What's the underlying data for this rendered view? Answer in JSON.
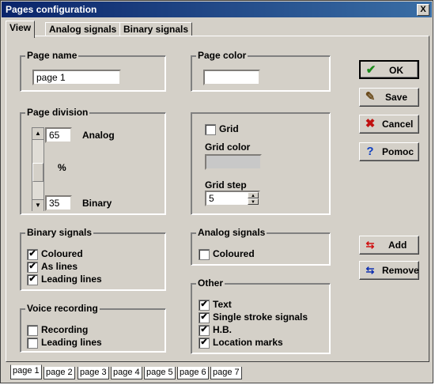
{
  "window": {
    "title": "Pages configuration",
    "close_label": "X"
  },
  "tabs": [
    "View",
    "Analog signals",
    "Binary signals"
  ],
  "page_name": {
    "title": "Page name",
    "value": "page 1"
  },
  "page_color": {
    "title": "Page color",
    "value": ""
  },
  "page_division": {
    "title": "Page division",
    "analog_value": "65",
    "analog_label": "Analog",
    "percent_label": "%",
    "binary_value": "35",
    "binary_label": "Binary"
  },
  "grid": {
    "grid_label": "Grid",
    "grid_checked": false,
    "color_label": "Grid color",
    "color_value": "#c8c8c8",
    "step_label": "Grid step",
    "step_value": "5"
  },
  "binary_signals": {
    "title": "Binary signals",
    "items": [
      {
        "label": "Coloured",
        "checked": true
      },
      {
        "label": "As lines",
        "checked": true
      },
      {
        "label": "Leading lines",
        "checked": true
      }
    ]
  },
  "analog_signals": {
    "title": "Analog signals",
    "items": [
      {
        "label": "Coloured",
        "checked": false
      }
    ]
  },
  "voice_recording": {
    "title": "Voice recording",
    "items": [
      {
        "label": "Recording",
        "checked": false
      },
      {
        "label": "Leading lines",
        "checked": false
      }
    ]
  },
  "other": {
    "title": "Other",
    "items": [
      {
        "label": "Text",
        "checked": true
      },
      {
        "label": "Single stroke signals",
        "checked": true
      },
      {
        "label": "H.B.",
        "checked": true
      },
      {
        "label": "Location marks",
        "checked": true
      }
    ]
  },
  "buttons": {
    "ok": "OK",
    "save": "Save",
    "cancel": "Cancel",
    "help": "Pomoc",
    "add": "Add",
    "remove": "Remove"
  },
  "check_mark": "✔",
  "page_tabs": [
    "page 1",
    "page 2",
    "page 3",
    "page 4",
    "page 5",
    "page 6",
    "page 7"
  ]
}
